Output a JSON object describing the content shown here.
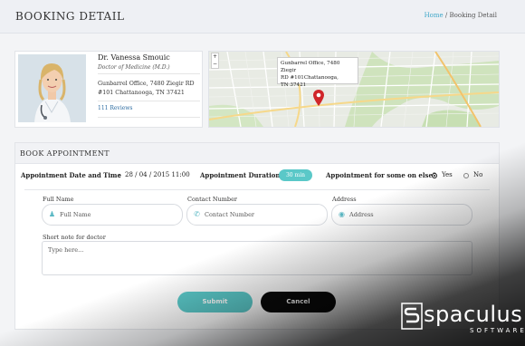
{
  "header": {
    "title": "BOOKING DETAIL",
    "breadcrumb_home": "Home",
    "breadcrumb_separator": " / ",
    "breadcrumb_current": "Booking Detail"
  },
  "doctor": {
    "name": "Dr. Vanessa Smouic",
    "title": "Doctor of Medicine (M.D.)",
    "address_line1": "Gunbarrel Office, 7480 Ziegir RD",
    "address_line2": "#101 Chattanooga, TN 37421",
    "reviews": "111 Reviews"
  },
  "map": {
    "zoom_in": "+",
    "zoom_out": "−",
    "popup_line1": "Gunbarrel Office, 7480 Ziegir",
    "popup_line2": "RD #101Chattanooga,",
    "popup_line3": "TN 37421"
  },
  "booking": {
    "section_title": "BOOK APPOINTMENT",
    "date_time_label": "Appointment Date and Time",
    "date_time_separator": ":",
    "date_time_value": "28 / 04 / 2015  11:00",
    "duration_label": "Appointment Duration",
    "duration_value": "30 min",
    "someone_else_label": "Appointment for some on else?",
    "yes_label": "Yes",
    "no_label": "No",
    "selected": "Yes"
  },
  "form": {
    "full_name_label": "Full Name",
    "full_name_placeholder": "Full Name",
    "contact_label": "Contact Number",
    "contact_placeholder": "Contact Number",
    "address_label": "Address",
    "address_placeholder": "Address",
    "note_label": "Short note for doctor",
    "note_placeholder": "Type here..."
  },
  "actions": {
    "submit_label": "Submit",
    "cancel_label": "Cancel"
  },
  "brand": {
    "word": "spaculus",
    "sub": "SOFTWARE"
  },
  "colors": {
    "accent": "#5ac8c8",
    "link": "#3fa7c9",
    "cancel": "#0a0a0a"
  }
}
